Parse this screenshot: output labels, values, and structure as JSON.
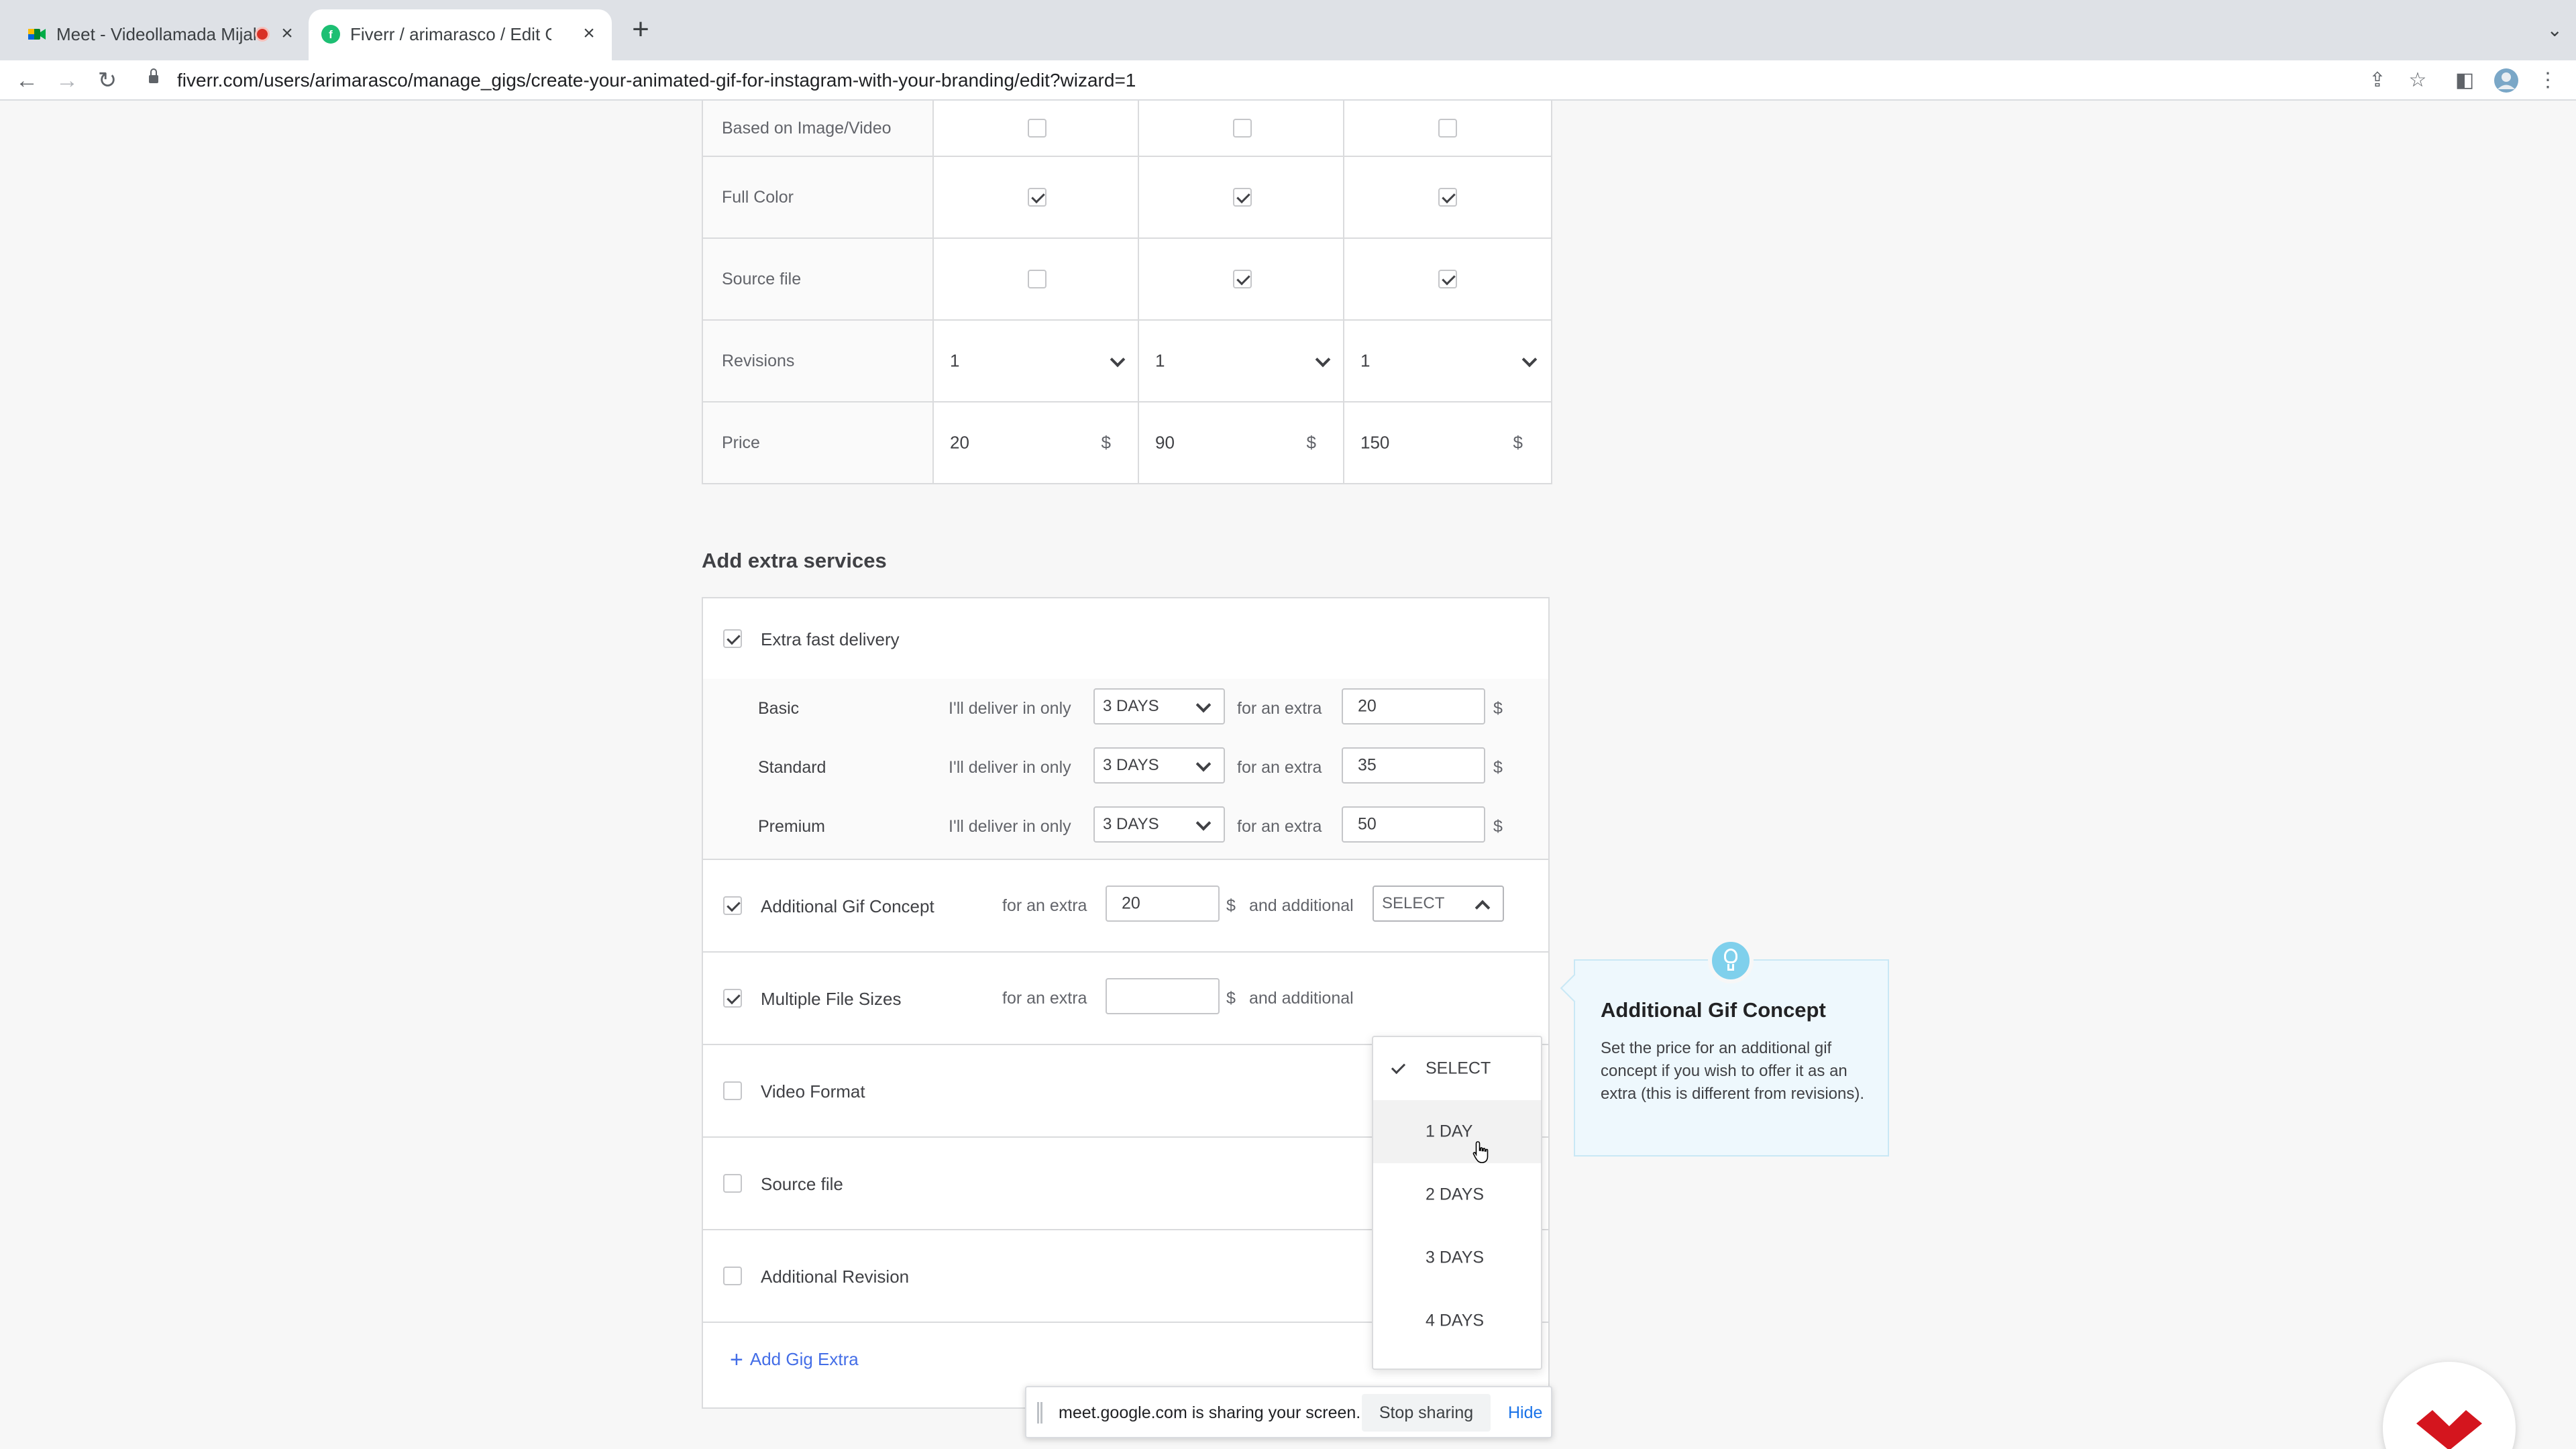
{
  "browser": {
    "tabs": [
      {
        "title": "Meet - Videollamada Mijal"
      },
      {
        "title": "Fiverr / arimarasco / Edit Gig"
      }
    ],
    "url": "fiverr.com/users/arimarasco/manage_gigs/create-your-animated-gif-for-instagram-with-your-branding/edit?wizard=1",
    "new_tab_symbol": "+",
    "close_symbol": "×"
  },
  "packages": {
    "rows": [
      {
        "label": "Based on Image/Video",
        "type": "checkbox",
        "values": [
          false,
          false,
          false
        ]
      },
      {
        "label": "Full Color",
        "type": "checkbox",
        "values": [
          true,
          true,
          true
        ]
      },
      {
        "label": "Source file",
        "type": "checkbox",
        "values": [
          false,
          true,
          true
        ]
      },
      {
        "label": "Revisions",
        "type": "select",
        "values": [
          "1",
          "1",
          "1"
        ]
      },
      {
        "label": "Price",
        "type": "price",
        "values": [
          "20",
          "90",
          "150"
        ],
        "currency": "$"
      }
    ]
  },
  "extras": {
    "title": "Add extra services",
    "fast_delivery": {
      "label": "Extra fast delivery",
      "checked": true,
      "deliver_text": "I'll deliver in only",
      "extra_text": "for an extra",
      "currency": "$",
      "tiers": [
        {
          "name": "Basic",
          "days": "3 DAYS",
          "price": "20"
        },
        {
          "name": "Standard",
          "days": "3 DAYS",
          "price": "35"
        },
        {
          "name": "Premium",
          "days": "3 DAYS",
          "price": "50"
        }
      ]
    },
    "gif_concept": {
      "label": "Additional Gif Concept",
      "checked": true,
      "extra_text": "for an extra",
      "price": "20",
      "currency": "$",
      "additional_text": "and additional",
      "select_value": "SELECT"
    },
    "file_sizes": {
      "label": "Multiple File Sizes",
      "checked": true,
      "extra_text": "for an extra",
      "price": "",
      "currency": "$",
      "additional_text": "and additional"
    },
    "video_format": {
      "label": "Video Format",
      "checked": false
    },
    "source_file": {
      "label": "Source file",
      "checked": false
    },
    "additional_revision": {
      "label": "Additional Revision",
      "checked": false
    },
    "add_link": "Add Gig Extra"
  },
  "dropdown": {
    "options": [
      "SELECT",
      "1 DAY",
      "2 DAYS",
      "3 DAYS",
      "4 DAYS"
    ],
    "selected": "SELECT",
    "hovered": "1 DAY"
  },
  "tip": {
    "title": "Additional Gif Concept",
    "body": "Set the price for an additional gif concept if you wish to offer it as an extra (this is different from revisions)."
  },
  "sharebar": {
    "message": "meet.google.com is sharing your screen.",
    "stop": "Stop sharing",
    "hide": "Hide"
  },
  "colors": {
    "link": "#446ee7",
    "brand_logo": "#d4151e",
    "tip_bg": "#eef8fd",
    "tip_icon": "#7fd0ec"
  }
}
